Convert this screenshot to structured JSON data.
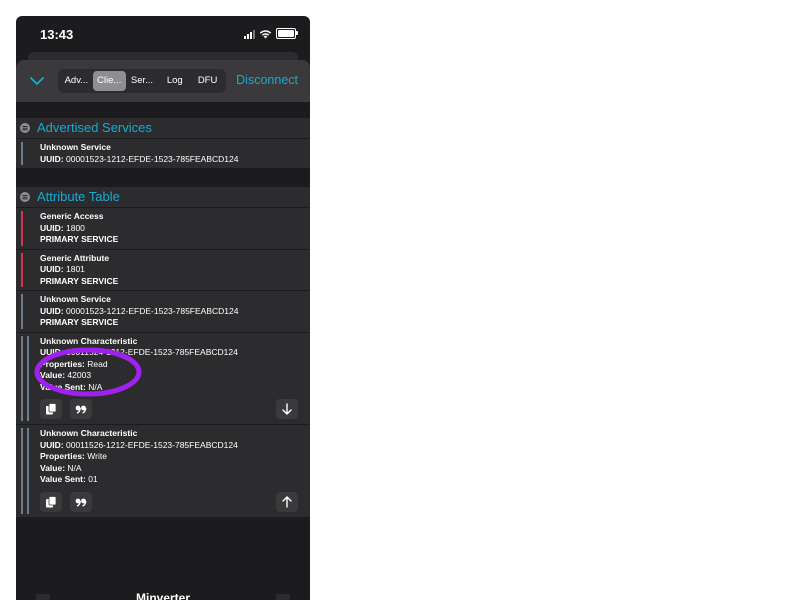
{
  "status_bar": {
    "time": "13:43"
  },
  "toolbar": {
    "tabs": [
      {
        "label": "Adv...",
        "active": false
      },
      {
        "label": "Clie...",
        "active": true
      },
      {
        "label": "Ser...",
        "active": false
      },
      {
        "label": "Log",
        "active": false
      },
      {
        "label": "DFU",
        "active": false
      }
    ],
    "disconnect_label": "Disconnect"
  },
  "advertised": {
    "title": "Advertised Services",
    "items": [
      {
        "name": "Unknown Service",
        "uuid_label": "UUID:",
        "uuid": "00001523-1212-EFDE-1523-785FEABCD124"
      }
    ]
  },
  "attribute_table": {
    "title": "Attribute Table",
    "services": [
      {
        "name": "Generic Access",
        "uuid_label": "UUID:",
        "uuid": "1800",
        "kind": "PRIMARY SERVICE"
      },
      {
        "name": "Generic Attribute",
        "uuid_label": "UUID:",
        "uuid": "1801",
        "kind": "PRIMARY SERVICE"
      },
      {
        "name": "Unknown Service",
        "uuid_label": "UUID:",
        "uuid": "00001523-1212-EFDE-1523-785FEABCD124",
        "kind": "PRIMARY SERVICE"
      }
    ],
    "characteristics": [
      {
        "name": "Unknown Characteristic",
        "uuid_label": "UUID:",
        "uuid": "00011524-1212-EFDE-1523-785FEABCD124",
        "properties_label": "Properties:",
        "properties": "Read",
        "value_label": "Value:",
        "value": "42003",
        "value_sent_label": "Value Sent:",
        "value_sent": "N/A"
      },
      {
        "name": "Unknown Characteristic",
        "uuid_label": "UUID:",
        "uuid": "00011526-1212-EFDE-1523-785FEABCD124",
        "properties_label": "Properties:",
        "properties": "Write",
        "value_label": "Value:",
        "value": "N/A",
        "value_sent_label": "Value Sent:",
        "value_sent": "01"
      }
    ]
  },
  "footer": {
    "title": "Minverter"
  },
  "colors": {
    "accent": "#1aa9cf",
    "background": "#1c1c1e",
    "row": "#2c2c2e",
    "red_marker": "#d6344a",
    "annotation": "#a020f0"
  }
}
